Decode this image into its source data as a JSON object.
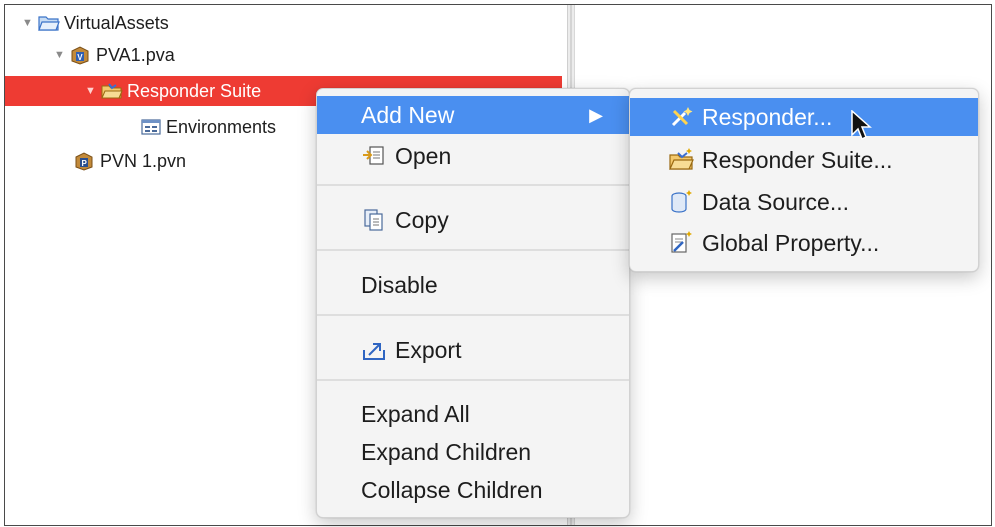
{
  "tree": {
    "items": [
      {
        "label": "VirtualAssets",
        "icon": "folder-open-icon"
      },
      {
        "label": "PVA1.pva",
        "icon": "pva-project-icon"
      },
      {
        "label": "Responder Suite",
        "icon": "responder-suite-icon"
      },
      {
        "label": "Environments",
        "icon": "environments-icon"
      },
      {
        "label": "PVN 1.pvn",
        "icon": "pvn-project-icon"
      }
    ]
  },
  "context_menu": {
    "items": [
      {
        "label": "Add New",
        "has_submenu": true
      },
      {
        "label": "Open",
        "icon": "open-icon"
      },
      {
        "label": "Copy",
        "icon": "copy-icon"
      },
      {
        "label": "Disable"
      },
      {
        "label": "Export",
        "icon": "export-icon"
      },
      {
        "label": "Expand All"
      },
      {
        "label": "Expand Children"
      },
      {
        "label": "Collapse Children"
      }
    ]
  },
  "submenu": {
    "items": [
      {
        "label": "Responder...",
        "icon": "responder-icon"
      },
      {
        "label": "Responder Suite...",
        "icon": "responder-suite-icon"
      },
      {
        "label": "Data Source...",
        "icon": "data-source-icon"
      },
      {
        "label": "Global Property...",
        "icon": "global-property-icon"
      }
    ]
  },
  "colors": {
    "selection": "#ee3b33",
    "menu_highlight": "#4a8ff0"
  }
}
